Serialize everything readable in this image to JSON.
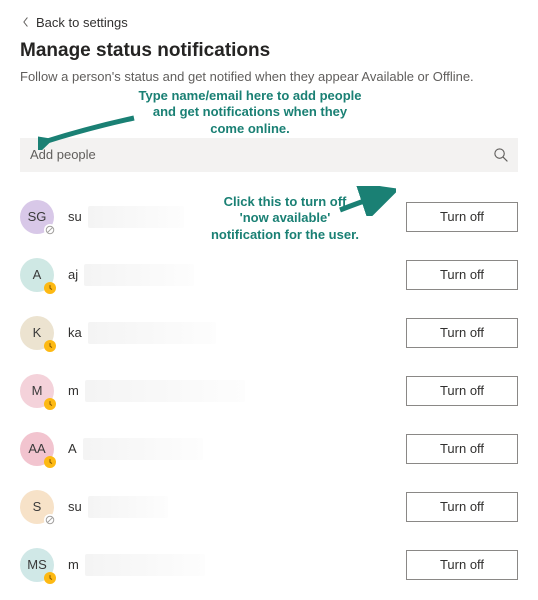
{
  "nav": {
    "back_label": "Back to settings"
  },
  "header": {
    "title": "Manage status notifications",
    "subtitle": "Follow a person's status and get notified when they appear Available or Offline."
  },
  "search": {
    "placeholder": "Add people"
  },
  "buttons": {
    "turn_off": "Turn off"
  },
  "people": [
    {
      "initials": "SG",
      "color": "#d8c8e8",
      "presence": "offline",
      "name_prefix": "su",
      "redact_width": 96
    },
    {
      "initials": "A",
      "color": "#cfe8e4",
      "presence": "away",
      "name_prefix": "aj",
      "redact_width": 110
    },
    {
      "initials": "K",
      "color": "#ece3d0",
      "presence": "away",
      "name_prefix": "ka",
      "redact_width": 128
    },
    {
      "initials": "M",
      "color": "#f4d2da",
      "presence": "away",
      "name_prefix": "m",
      "redact_width": 160
    },
    {
      "initials": "AA",
      "color": "#f2c4cf",
      "presence": "away",
      "name_prefix": "A",
      "redact_width": 120
    },
    {
      "initials": "S",
      "color": "#f7e2c8",
      "presence": "offline",
      "name_prefix": "su",
      "redact_width": 80
    },
    {
      "initials": "MS",
      "color": "#d0e8e7",
      "presence": "away",
      "name_prefix": "m",
      "redact_width": 120
    }
  ],
  "annotations": {
    "search_hint": "Type name/email here to add people and get notifications when they come online.",
    "turnoff_hint": "Click this to turn off 'now available' notification for the user."
  }
}
